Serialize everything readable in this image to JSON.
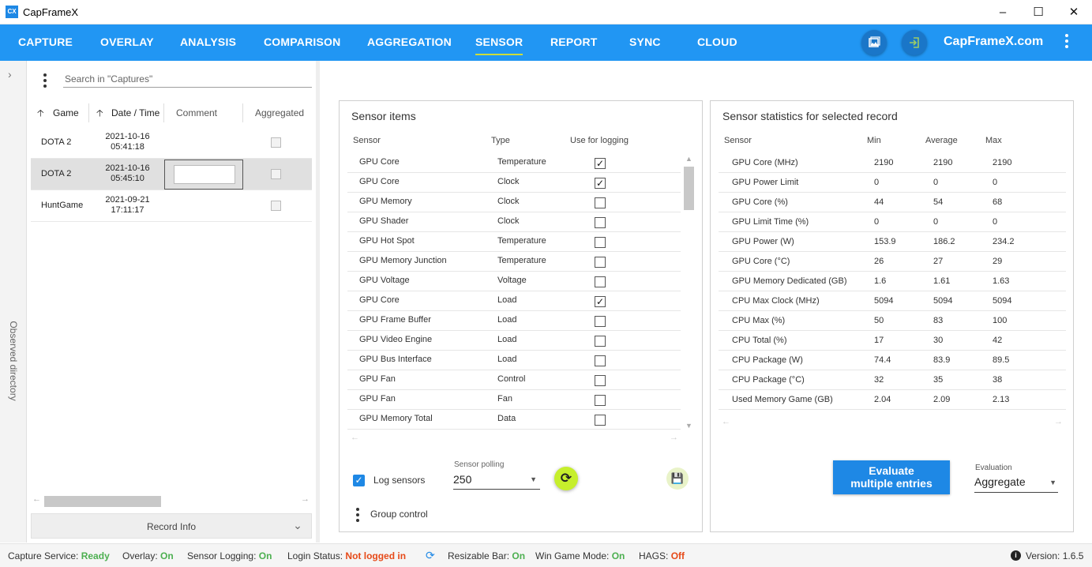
{
  "window": {
    "title": "CapFrameX",
    "icon_text": "CX"
  },
  "nav": {
    "tabs": [
      "CAPTURE",
      "OVERLAY",
      "ANALYSIS",
      "COMPARISON",
      "AGGREGATION",
      "SENSOR",
      "REPORT",
      "SYNC",
      "CLOUD"
    ],
    "active_tab": "SENSOR",
    "site_link": "CapFrameX.com",
    "accent_color": "#2196f3",
    "active_underline_color": "#cddc39"
  },
  "left_gutter": {
    "label": "Observed directory"
  },
  "captures": {
    "search_placeholder": "Search in \"Captures\"",
    "columns": {
      "game": "Game",
      "date": "Date / Time",
      "comment": "Comment",
      "aggregated": "Aggregated"
    },
    "rows": [
      {
        "game": "DOTA 2",
        "date": "2021-10-16",
        "time": "05:41:18",
        "selected": false
      },
      {
        "game": "DOTA 2",
        "date": "2021-10-16",
        "time": "05:45:10",
        "selected": true
      },
      {
        "game": "HuntGame",
        "date": "2021-09-21",
        "time": "17:11:17",
        "selected": false
      }
    ],
    "record_info_label": "Record Info"
  },
  "sensor_items": {
    "title": "Sensor items",
    "columns": {
      "sensor": "Sensor",
      "type": "Type",
      "use": "Use for logging"
    },
    "rows": [
      {
        "sensor": "GPU Core",
        "type": "Temperature",
        "checked": true
      },
      {
        "sensor": "GPU Core",
        "type": "Clock",
        "checked": true
      },
      {
        "sensor": "GPU Memory",
        "type": "Clock",
        "checked": false
      },
      {
        "sensor": "GPU Shader",
        "type": "Clock",
        "checked": false
      },
      {
        "sensor": "GPU Hot Spot",
        "type": "Temperature",
        "checked": false
      },
      {
        "sensor": "GPU Memory Junction",
        "type": "Temperature",
        "checked": false
      },
      {
        "sensor": "GPU Voltage",
        "type": "Voltage",
        "checked": false
      },
      {
        "sensor": "GPU Core",
        "type": "Load",
        "checked": true
      },
      {
        "sensor": "GPU Frame Buffer",
        "type": "Load",
        "checked": false
      },
      {
        "sensor": "GPU Video Engine",
        "type": "Load",
        "checked": false
      },
      {
        "sensor": "GPU Bus Interface",
        "type": "Load",
        "checked": false
      },
      {
        "sensor": "GPU Fan",
        "type": "Control",
        "checked": false
      },
      {
        "sensor": "GPU Fan",
        "type": "Fan",
        "checked": false
      },
      {
        "sensor": "GPU Memory Total",
        "type": "Data",
        "checked": false
      }
    ],
    "log_sensors_label": "Log sensors",
    "log_sensors_checked": true,
    "polling_caption": "Sensor polling",
    "polling_value": "250",
    "group_control_label": "Group control"
  },
  "sensor_stats": {
    "title": "Sensor statistics for selected record",
    "columns": {
      "sensor": "Sensor",
      "min": "Min",
      "avg": "Average",
      "max": "Max"
    },
    "rows": [
      {
        "sensor": "GPU Core (MHz)",
        "min": "2190",
        "avg": "2190",
        "max": "2190"
      },
      {
        "sensor": "GPU Power Limit",
        "min": "0",
        "avg": "0",
        "max": "0"
      },
      {
        "sensor": "GPU Core (%)",
        "min": "44",
        "avg": "54",
        "max": "68"
      },
      {
        "sensor": "GPU Limit Time (%)",
        "min": "0",
        "avg": "0",
        "max": "0"
      },
      {
        "sensor": "GPU Power (W)",
        "min": "153.9",
        "avg": "186.2",
        "max": "234.2"
      },
      {
        "sensor": "GPU Core (°C)",
        "min": "26",
        "avg": "27",
        "max": "29"
      },
      {
        "sensor": "GPU Memory Dedicated (GB)",
        "min": "1.6",
        "avg": "1.61",
        "max": "1.63"
      },
      {
        "sensor": "CPU Max Clock (MHz)",
        "min": "5094",
        "avg": "5094",
        "max": "5094"
      },
      {
        "sensor": "CPU Max (%)",
        "min": "50",
        "avg": "83",
        "max": "100"
      },
      {
        "sensor": "CPU Total (%)",
        "min": "17",
        "avg": "30",
        "max": "42"
      },
      {
        "sensor": "CPU Package (W)",
        "min": "74.4",
        "avg": "83.9",
        "max": "89.5"
      },
      {
        "sensor": "CPU Package (°C)",
        "min": "32",
        "avg": "35",
        "max": "38"
      },
      {
        "sensor": "Used Memory Game (GB)",
        "min": "2.04",
        "avg": "2.09",
        "max": "2.13"
      }
    ],
    "evaluate_line1": "Evaluate",
    "evaluate_line2": "multiple entries",
    "evaluation_caption": "Evaluation",
    "evaluation_value": "Aggregate"
  },
  "statusbar": {
    "capture_label": "Capture Service:",
    "capture_value": "Ready",
    "overlay_label": "Overlay:",
    "overlay_value": "On",
    "logging_label": "Sensor Logging:",
    "logging_value": "On",
    "login_label": "Login Status:",
    "login_value": "Not logged in",
    "rebar_label": "Resizable Bar:",
    "rebar_value": "On",
    "gamemode_label": "Win Game Mode:",
    "gamemode_value": "On",
    "hags_label": "HAGS:",
    "hags_value": "Off",
    "version": "Version: 1.6.5",
    "ok_color": "#4caf50",
    "bad_color": "#e64a19"
  }
}
